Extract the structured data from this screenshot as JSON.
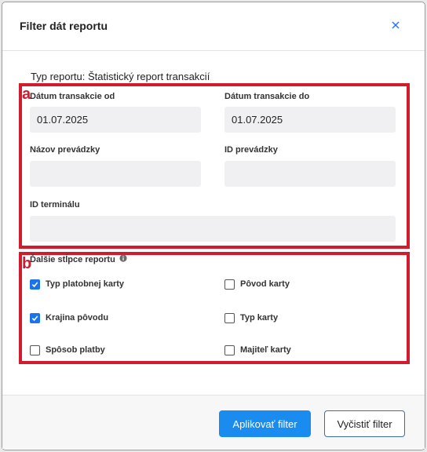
{
  "dialog": {
    "title": "Filter dát reportu"
  },
  "report_type": "Typ reportu: Štatistický report transakcií",
  "annotations": {
    "a": "a",
    "b": "b"
  },
  "fields": {
    "date_from": {
      "label": "Dátum transakcie od",
      "value": "01.07.2025"
    },
    "date_to": {
      "label": "Dátum transakcie do",
      "value": "01.07.2025"
    },
    "shop_name": {
      "label": "Názov prevádzky",
      "value": ""
    },
    "shop_id": {
      "label": "ID prevádzky",
      "value": ""
    },
    "terminal_id": {
      "label": "ID terminálu",
      "value": ""
    }
  },
  "columns": {
    "label": "Ďalšie stĺpce reportu",
    "items": [
      {
        "label": "Typ platobnej karty",
        "checked": true
      },
      {
        "label": "Pôvod karty",
        "checked": false
      },
      {
        "label": "Krajina pôvodu",
        "checked": true
      },
      {
        "label": "Typ karty",
        "checked": false
      },
      {
        "label": "Spôsob platby",
        "checked": false
      },
      {
        "label": "Majiteľ karty",
        "checked": false
      }
    ]
  },
  "footer": {
    "apply_label": "Aplikovať filter",
    "clear_label": "Vyčistiť filter"
  },
  "colors": {
    "accent": "#1a8cf0",
    "annotation": "#d21b2c",
    "checkbox_checked": "#1a73e8"
  },
  "icons": {
    "close": "close-icon",
    "info": "info-icon",
    "check": "check-icon"
  }
}
